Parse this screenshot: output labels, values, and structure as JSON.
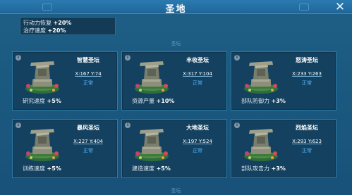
{
  "window": {
    "title": "圣地",
    "close_glyph": "✕"
  },
  "current_buff": {
    "lines": [
      {
        "label": "行动力恢复",
        "value": "+20%"
      },
      {
        "label": "治疗速度",
        "value": "+20%"
      }
    ]
  },
  "section_labels": {
    "top": "圣坛",
    "bottom": "圣坛"
  },
  "altars": [
    {
      "name": "智慧圣坛",
      "coords": "X:167 Y:74",
      "status": "正常",
      "buff_label": "研究速度",
      "buff_value": "+5%"
    },
    {
      "name": "丰收圣坛",
      "coords": "X:317 Y:104",
      "status": "正常",
      "buff_label": "资源产量",
      "buff_value": "+10%"
    },
    {
      "name": "怒涛圣坛",
      "coords": "X:233 Y:263",
      "status": "正常",
      "buff_label": "部队防御力",
      "buff_value": "+3%"
    },
    {
      "name": "暴风圣坛",
      "coords": "X:227 Y:404",
      "status": "正常",
      "buff_label": "训练速度",
      "buff_value": "+5%"
    },
    {
      "name": "大地圣坛",
      "coords": "X:197 Y:524",
      "status": "正常",
      "buff_label": "建造速度",
      "buff_value": "+5%"
    },
    {
      "name": "烈焰圣坛",
      "coords": "X:293 Y:623",
      "status": "正常",
      "buff_label": "部队攻击力",
      "buff_value": "+3%"
    }
  ],
  "colors": {
    "panel_bg": "#1b5a80",
    "card_bg": "#14415f",
    "status_blue": "#55b8ff",
    "title_bar": "#2b7ab0"
  }
}
